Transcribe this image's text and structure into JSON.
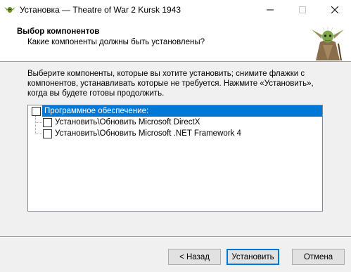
{
  "window": {
    "title": "Установка — Theatre of War 2 Kursk 1943",
    "icons": {
      "app": "yoda-icon",
      "minimize": "minimize-icon",
      "maximize": "maximize-icon",
      "close": "close-icon"
    }
  },
  "header": {
    "title": "Выбор компонентов",
    "subtitle": "Какие компоненты должны быть установлены?",
    "image": "yoda-wizard-image"
  },
  "instructions": "Выберите компоненты, которые вы хотите установить; снимите флажки с компонентов, устанавливать которые не требуется. Нажмите «Установить», когда вы будете готовы продолжить.",
  "components": {
    "root": {
      "label": "Программное обеспечение:",
      "checked": false,
      "selected": true
    },
    "items": [
      {
        "label": "Установить\\Обновить Microsoft DirectX",
        "checked": false
      },
      {
        "label": "Установить\\Обновить Microsoft .NET Framework 4",
        "checked": false
      }
    ]
  },
  "buttons": {
    "back": "< Назад",
    "install": "Установить",
    "cancel": "Отмена"
  },
  "colors": {
    "selection": "#0078d7",
    "header_bg": "#ffffff",
    "dialog_bg": "#f0f0f0"
  }
}
